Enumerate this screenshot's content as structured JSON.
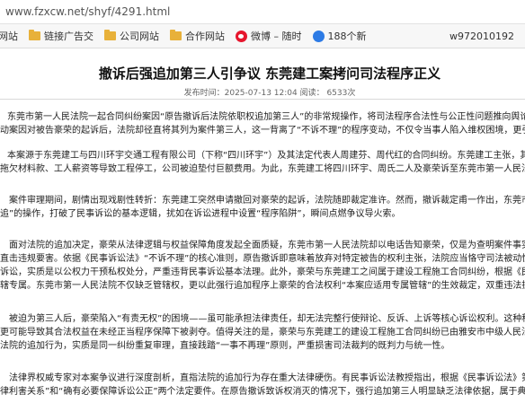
{
  "browser": {
    "url": "www.fzxcw.net/shyf/4291.html",
    "bookmarks": [
      {
        "label": "网站",
        "icon": "folder-icon"
      },
      {
        "label": "链接广告交",
        "icon": "folder-icon"
      },
      {
        "label": "公司网站",
        "icon": "folder-icon"
      },
      {
        "label": "合作网站",
        "icon": "folder-icon"
      },
      {
        "label": "微博 – 随时",
        "icon": "weibo-icon"
      },
      {
        "label": "188个新",
        "icon": "baidu-paw-icon"
      }
    ],
    "bookmark_right": "w972010192"
  },
  "article": {
    "title": "撤诉后强追加第三人引争议 东莞建工案拷问司法程序正义",
    "meta": "发布时间：2025-07-13 12:04 阅读： 6533次",
    "paragraphs": [
      [
        "东莞市第一人民法院一起合同纠纷案因“原告撤诉后法院依职权追加第三人”的非常规操作，将司法程序合法性与公正性问题推向舆论风暴中心。",
        "动案因对被告豪荣的起诉后，法院却径直将其列为案件第三人，这一背离了“不诉不理”的程序变动，不仅令当事人陷入维权困境，更引发法律界"
      ],
      [
        "本案源于东莞建工与四川环宇交通工程有限公司（下称“四川环宇”）及其法定代表人周建芬、周代红的合同纠纷。东莞建工主张，其成都分",
        "拖欠材料款、工人薪资等导致工程停工，公司被迫垫付巨额费用。为此，东莞建工将四川环宇、周氏二人及豪荣诉至东莞市第一人民法院，要求"
      ],
      [
        "案件审理期间，剧情出现戏剧性转折：东莞建工突然申请撤回对豪荣的起诉，法院随即裁定准许。然而，撤诉裁定甫一作出，东莞市第一人民",
        "追”的操作，打破了民事诉讼的基本逻辑，扰如在诉讼进程中设置“程序陷阱”，瞬间点燃争议导火索。"
      ],
      [
        "面对法院的追加决定，豪荣从法律逻辑与权益保障角度发起全面质疑，东莞市第一人民法院却以电话告知豪荣，仅是为查明案件事实追加豪荣为",
        "直击违规要害。依据《民事诉讼法》“不诉不理”的核心准则，原告撤诉即意味着放弃对特定被告的权利主张，法院应当恪守司法被动性。但本案中",
        "诉讼，实质是以公权力干预私权处分，严重违背民事诉讼基本法理。此外，豪荣与东莞建工之间属于建设工程施工合同纠纷，根据《民事诉讼法》",
        "辖专属。东莞市第一人民法院不仅缺乏管辖权，更以此强行追加程序上豪荣的合法权利“本案应适用专属管辖”的生效裁定，双重违法操作直接削减法院的"
      ],
      [
        "被迫为第三人后，豪荣陷入“有责无权”的困境——虽可能承担法律责任，却无法完整行使辩论、反诉、上诉等核心诉讼权利。这种程序设置不",
        "更可能导致其合法权益在未经正当程序保障下被剥夺。值得关注的是，豪荣与东莞建工的建设工程施工合同纠纷已由雅安市中级人民法院审理中",
        "法院的追加行为，实质是同一纠纷重复审理，直接践踏“一事不再理”原则，严重损害司法裁判的既判力与统一性。"
      ],
      [
        "法律界权威专家对本案争议进行深度剖析，直指法院的追加行为存在重大法律硬伤。有民事诉讼法教授指出，根据《民事诉讼法》第59条，法院",
        "律利害关系”和“确有必要保障诉讼公正”两个法定要件。在原告撤诉致诉权消灭的情况下，强行追加第三人明显缺乏法律依据，属于典型的程序"
      ]
    ]
  }
}
